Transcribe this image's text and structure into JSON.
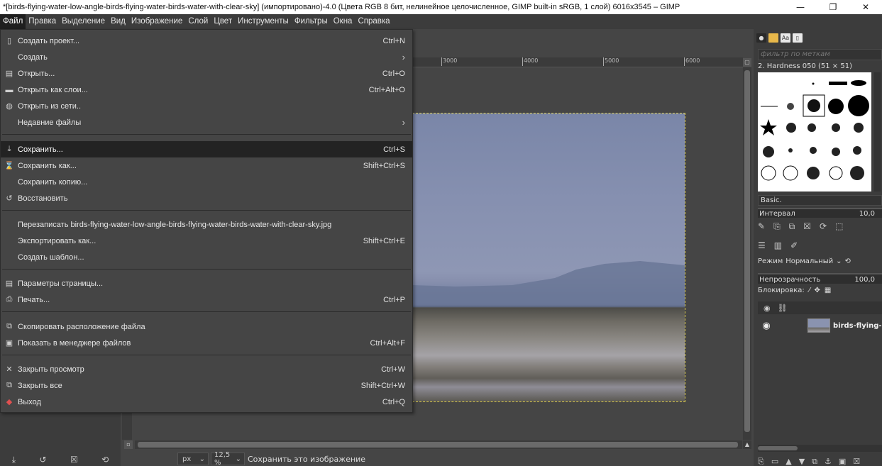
{
  "window": {
    "title": "*[birds-flying-water-low-angle-birds-flying-water-birds-water-with-clear-sky] (импортировано)-4.0 (Цвета RGB 8 бит, нелинейное целочисленное, GIMP built-in sRGB, 1 слой) 6016x3545 – GIMP",
    "minimize": "—",
    "maximize": "❐",
    "close": "✕"
  },
  "menubar": [
    "Файл",
    "Правка",
    "Выделение",
    "Вид",
    "Изображение",
    "Слой",
    "Цвет",
    "Инструменты",
    "Фильтры",
    "Окна",
    "Справка"
  ],
  "file_menu": {
    "items": [
      {
        "label": "Создать проект...",
        "shortcut": "Ctrl+N",
        "icon": "new-icon"
      },
      {
        "label": "Создать",
        "shortcut": "",
        "icon": "",
        "submenu": true
      },
      {
        "label": "Открыть...",
        "shortcut": "Ctrl+O",
        "icon": "open-icon"
      },
      {
        "label": "Открыть как слои...",
        "shortcut": "Ctrl+Alt+O",
        "icon": "open-layers-icon"
      },
      {
        "label": "Открыть из сети..",
        "shortcut": "",
        "icon": "globe-icon"
      },
      {
        "label": "Недавние файлы",
        "shortcut": "",
        "icon": "",
        "submenu": true
      },
      {
        "label": "Сохранить...",
        "shortcut": "Ctrl+S",
        "icon": "save-icon",
        "highlighted": true
      },
      {
        "label": "Сохранить как...",
        "shortcut": "Shift+Ctrl+S",
        "icon": "save-as-icon"
      },
      {
        "label": "Сохранить копию...",
        "shortcut": "",
        "icon": ""
      },
      {
        "label": "Восстановить",
        "shortcut": "",
        "icon": "revert-icon"
      },
      {
        "label": "Перезаписать birds-flying-water-low-angle-birds-flying-water-birds-water-with-clear-sky.jpg",
        "shortcut": "",
        "icon": ""
      },
      {
        "label": "Экспортировать как...",
        "shortcut": "Shift+Ctrl+E",
        "icon": ""
      },
      {
        "label": "Создать шаблон...",
        "shortcut": "",
        "icon": ""
      },
      {
        "label": "Параметры страницы...",
        "shortcut": "",
        "icon": "page-setup-icon"
      },
      {
        "label": "Печать...",
        "shortcut": "Ctrl+P",
        "icon": "print-icon"
      },
      {
        "label": "Скопировать расположение файла",
        "shortcut": "",
        "icon": "copy-icon"
      },
      {
        "label": "Показать в менеджере файлов",
        "shortcut": "Ctrl+Alt+F",
        "icon": "file-manager-icon"
      },
      {
        "label": "Закрыть просмотр",
        "shortcut": "Ctrl+W",
        "icon": "close-icon"
      },
      {
        "label": "Закрыть все",
        "shortcut": "Shift+Ctrl+W",
        "icon": "close-all-icon"
      },
      {
        "label": "Выход",
        "shortcut": "Ctrl+Q",
        "icon": "quit-icon"
      }
    ]
  },
  "ruler": {
    "ticks": [
      "3000",
      "4000",
      "5000",
      "6000"
    ]
  },
  "statusbar": {
    "unit": "px",
    "zoom": "12,5 %",
    "message": "Сохранить это изображение"
  },
  "dock": {
    "filter_placeholder": "фильтр по меткам",
    "brush_name": "2. Hardness 050 (51 × 51)",
    "preset": "Basic.",
    "interval_label": "Интервал",
    "interval_value": "10,0",
    "mode_label": "Режим",
    "mode_value": "Нормальный",
    "opacity_label": "Непрозрачность",
    "opacity_value": "100,0",
    "lock_label": "Блокировка:",
    "layer_name": "birds-flying-"
  },
  "colors": {
    "menu_bg": "#454545",
    "highlight": "#232323",
    "selection_outline": "#d9c94a"
  }
}
